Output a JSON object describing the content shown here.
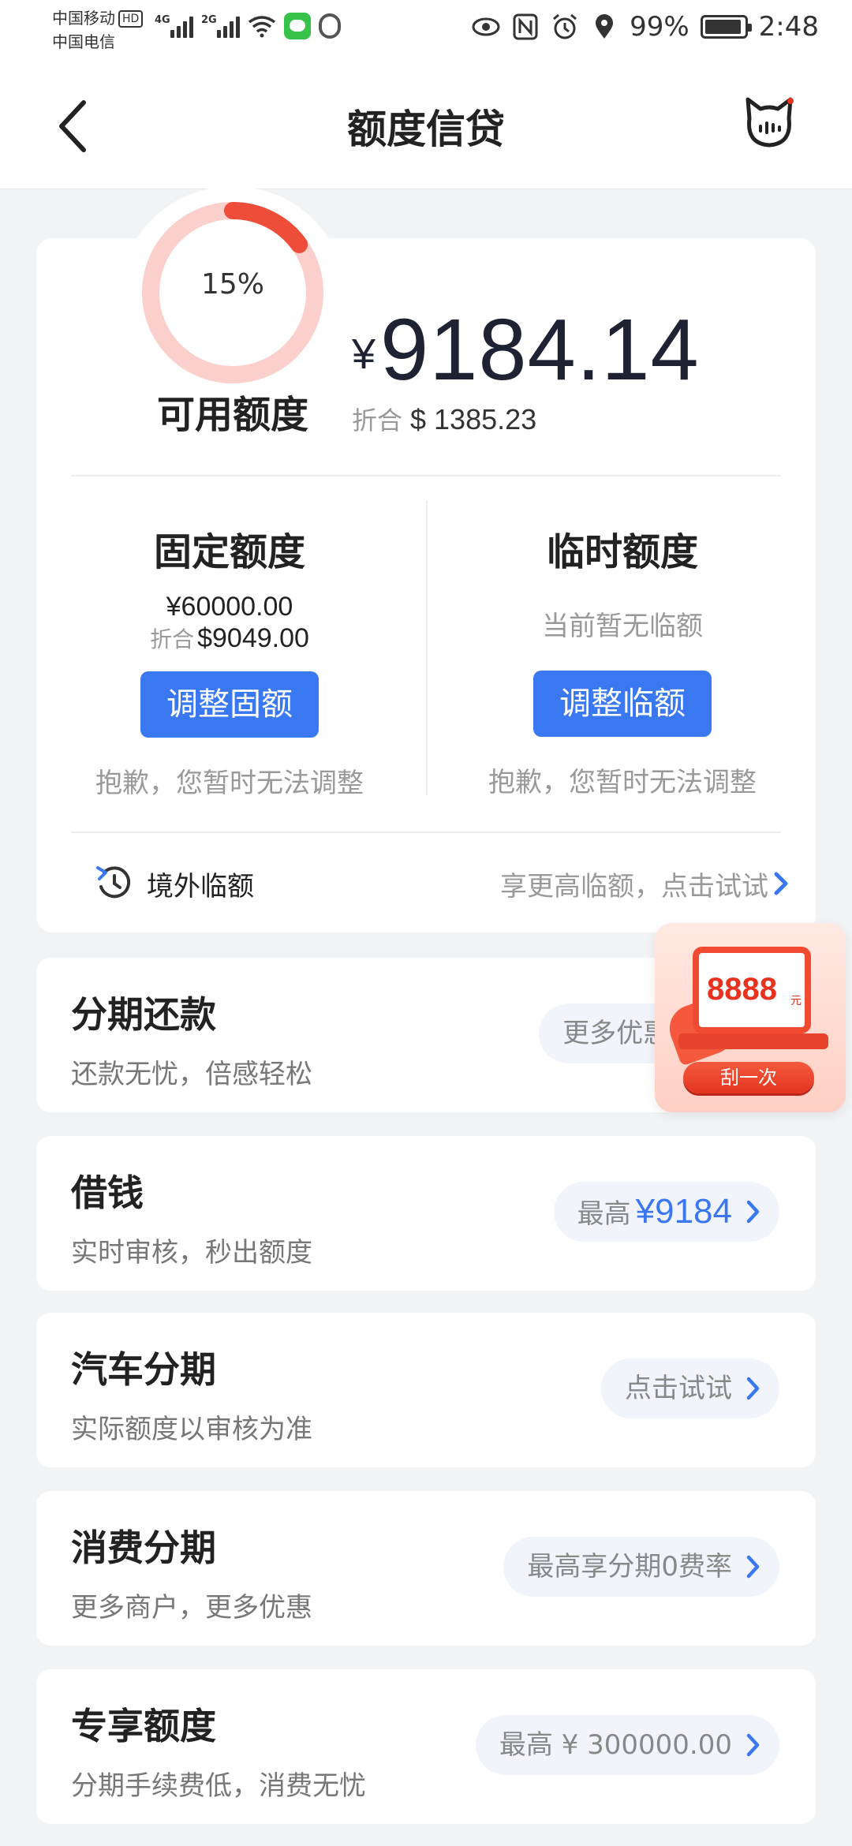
{
  "status_bar": {
    "carrier_1": "中国移动",
    "carrier_1_badge": "HD",
    "carrier_2": "中国电信",
    "sig1_label": "4G",
    "sig2_label": "2G",
    "battery": "99%",
    "time": "2:48"
  },
  "header": {
    "title": "额度信贷"
  },
  "credit": {
    "percent": "15%",
    "percent_value": 0.15,
    "available_label": "可用额度",
    "currency_symbol": "¥",
    "available_amount": "9184.14",
    "usd_label": "折合",
    "usd_amount": "$ 1385.23",
    "fixed": {
      "title": "固定额度",
      "amount": "¥60000.00",
      "usd_label": "折合",
      "usd_amount": "$9049.00",
      "button": "调整固额",
      "note": "抱歉，您暂时无法调整"
    },
    "temporary": {
      "title": "临时额度",
      "status": "当前暂无临额",
      "button": "调整临额",
      "note": "抱歉，您暂时无法调整"
    },
    "overseas": {
      "label": "境外临额",
      "hint": "享更高临额，点击试试"
    }
  },
  "products": [
    {
      "title": "分期还款",
      "subtitle": "还款无忧，倍感轻松",
      "pill_text": "更多优惠 戳我",
      "pill_highlight": ""
    },
    {
      "title": "借钱",
      "subtitle": "实时审核，秒出额度",
      "pill_text": "最高",
      "pill_highlight": "¥9184"
    },
    {
      "title": "汽车分期",
      "subtitle": "实际额度以审核为准",
      "pill_text": "点击试试",
      "pill_highlight": ""
    },
    {
      "title": "消费分期",
      "subtitle": "更多商户，更多优惠",
      "pill_text": "最高享分期0费率",
      "pill_highlight": ""
    },
    {
      "title": "专享额度",
      "subtitle": "分期手续费低，消费无忧",
      "pill_text": "最高 ¥ 300000.00",
      "pill_highlight": ""
    }
  ],
  "promo": {
    "amount": "8888",
    "unit": "元",
    "button": "刮一次"
  },
  "colors": {
    "accent_blue": "#3a78f2",
    "ring_red": "#ee4d3a",
    "ring_light": "#fbd0cc"
  }
}
